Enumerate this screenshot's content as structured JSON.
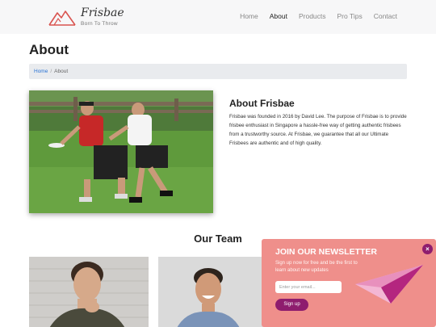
{
  "header": {
    "logo_name": "Frisbae",
    "logo_tagline": "Born To Throw",
    "nav": [
      {
        "label": "Home"
      },
      {
        "label": "About"
      },
      {
        "label": "Products"
      },
      {
        "label": "Pro Tips"
      },
      {
        "label": "Contact"
      }
    ],
    "active_nav": "About"
  },
  "page": {
    "title": "About",
    "breadcrumb": {
      "home": "Home",
      "separator": "/",
      "current": "About"
    }
  },
  "about": {
    "heading": "About Frisbae",
    "text": "Frisbae was founded in 2016 by David Lee. The purpose of Frisbae is to provide frisbee enthusiast in Singapore a hassle-free way of getting authentic frisbees from a trustworthy source. At Frisbae, we guarantee that all our Ultimate Frisbees are authentic and of high quality."
  },
  "team": {
    "heading": "Our Team"
  },
  "newsletter": {
    "title": "JOIN OUR NEWSLETTER",
    "subtitle": "Sign up now for free and be the first to learn about new updates",
    "email_placeholder": "Enter your email...",
    "button_label": "Sign up",
    "close_symbol": "×"
  },
  "colors": {
    "header_bg": "#f7f7f8",
    "breadcrumb_bg": "#e9ebee",
    "link_blue": "#2a73d4",
    "newsletter_bg": "#ef8f8b",
    "accent_purple": "#8e1d6e",
    "logo_red": "#d9534f"
  },
  "icons": {
    "logo": "mountain-logo-icon",
    "close": "close-icon",
    "plane": "paper-plane-icon"
  }
}
